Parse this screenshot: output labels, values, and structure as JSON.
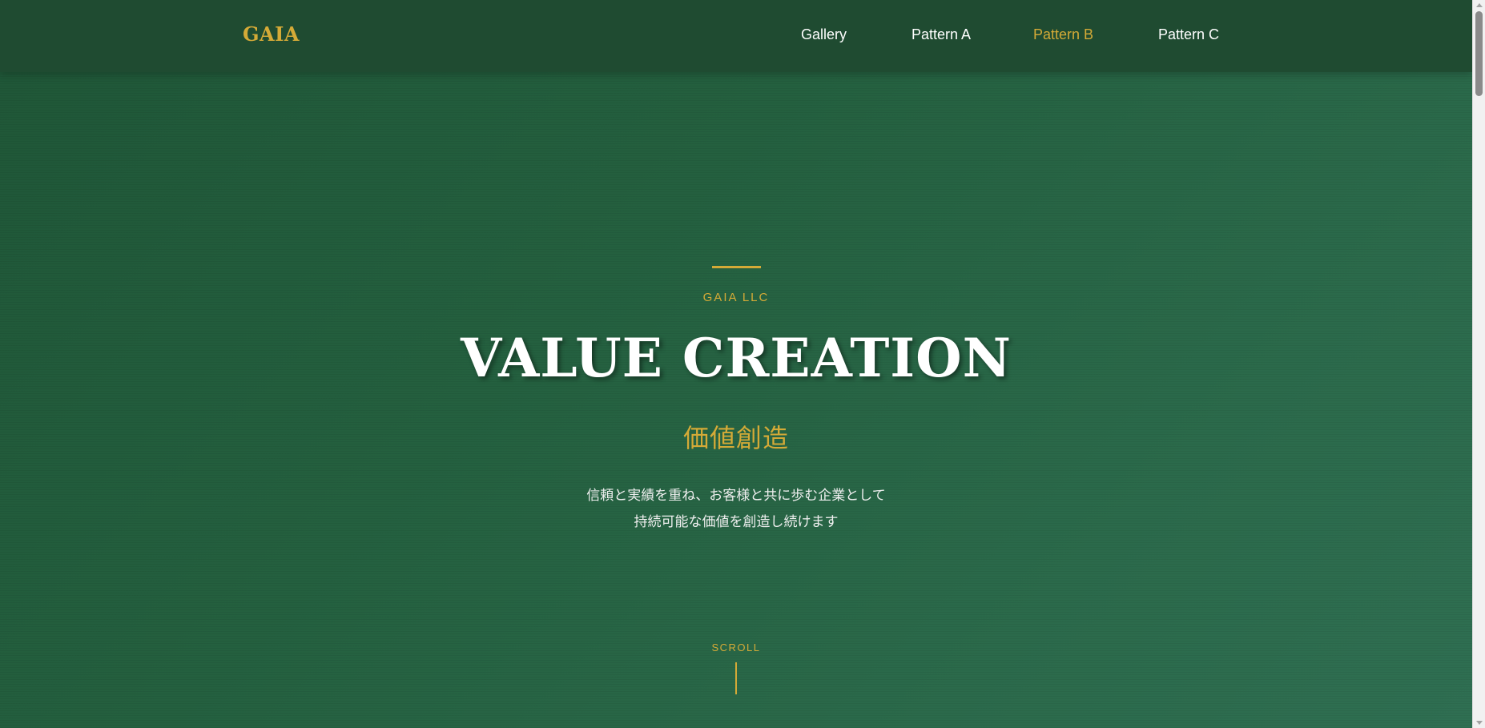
{
  "header": {
    "logo": "GAIA",
    "nav": [
      {
        "label": "Gallery",
        "active": false
      },
      {
        "label": "Pattern A",
        "active": false
      },
      {
        "label": "Pattern B",
        "active": true
      },
      {
        "label": "Pattern C",
        "active": false
      }
    ]
  },
  "hero": {
    "company": "GAIA LLC",
    "headline": "VALUE CREATION",
    "subheadline": "価値創造",
    "description": [
      "信頼と実績を重ね、お客様と共に歩む企業として",
      "持続可能な価値を創造し続けます"
    ],
    "scroll_label": "SCROLL"
  },
  "colors": {
    "accent_gold": "#d4aa37",
    "header_bg": "#1f4b31",
    "hero_green": "#24603f",
    "text_white": "#ffffff"
  }
}
